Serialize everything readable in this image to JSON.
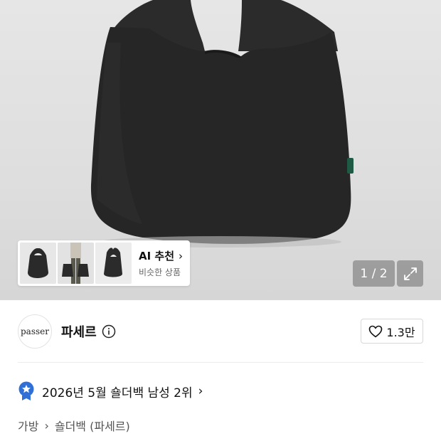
{
  "hero": {
    "image_alt": "black canvas tote bag",
    "counter_current": "1",
    "counter_sep": " / ",
    "counter_total": "2",
    "expand_icon": "expand-icon"
  },
  "ai_recommend": {
    "title": "AI 추천",
    "subtitle": "비슷한 상품",
    "chevron": "›"
  },
  "brand": {
    "logo_text": "passer",
    "name": "파세르",
    "info_icon": "info-icon",
    "likes": "1.3만",
    "heart_icon": "heart-icon"
  },
  "ranking": {
    "text": "2026년 5월 숄더백 남성 2위",
    "chevron": "›",
    "badge_icon": "star-badge-icon",
    "badge_color": "#2f6fd6"
  },
  "category": {
    "level1": "가방",
    "separator": "›",
    "level2": "숄더백 (파세르)"
  }
}
